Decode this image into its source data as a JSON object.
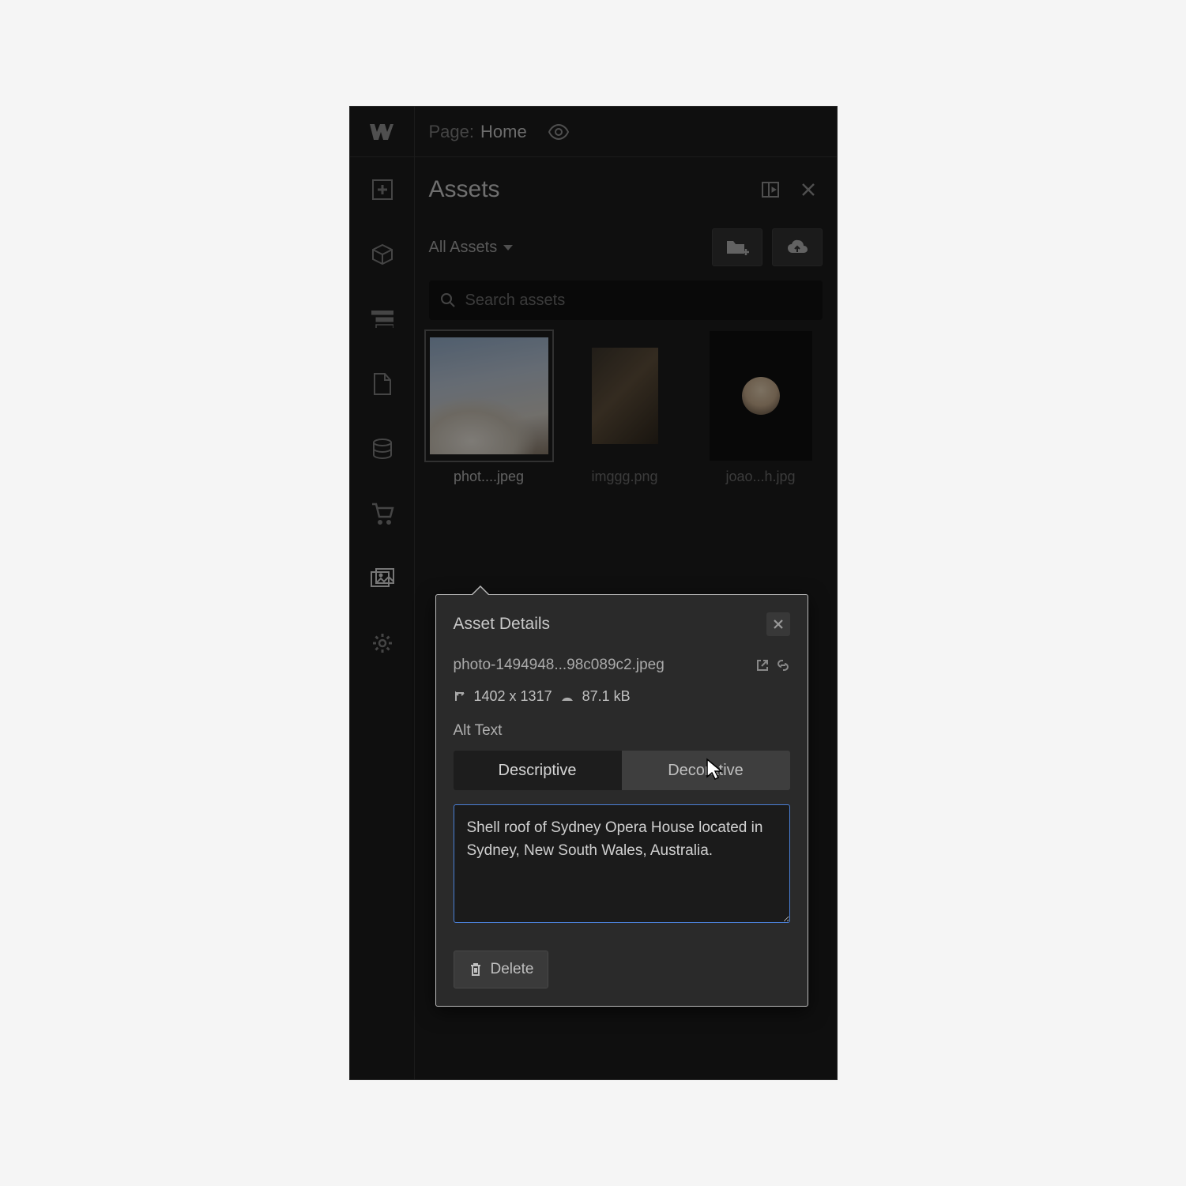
{
  "topbar": {
    "page_label": "Page:",
    "page_name": "Home"
  },
  "panel": {
    "title": "Assets",
    "folder": "All Assets",
    "search_placeholder": "Search assets"
  },
  "assets": [
    {
      "label": "phot....jpeg",
      "selected": true
    },
    {
      "label": "imggg.png",
      "selected": false
    },
    {
      "label": "joao...h.jpg",
      "selected": false
    }
  ],
  "details": {
    "title": "Asset Details",
    "filename": "photo-1494948...98c089c2.jpeg",
    "dimensions": "1402 x 1317",
    "filesize": "87.1 kB",
    "alt_label": "Alt Text",
    "tabs": {
      "descriptive": "Descriptive",
      "decorative": "Decorative"
    },
    "alt_value": "Shell roof of Sydney Opera House located in Sydney, New South Wales, Australia.",
    "delete_label": "Delete"
  }
}
